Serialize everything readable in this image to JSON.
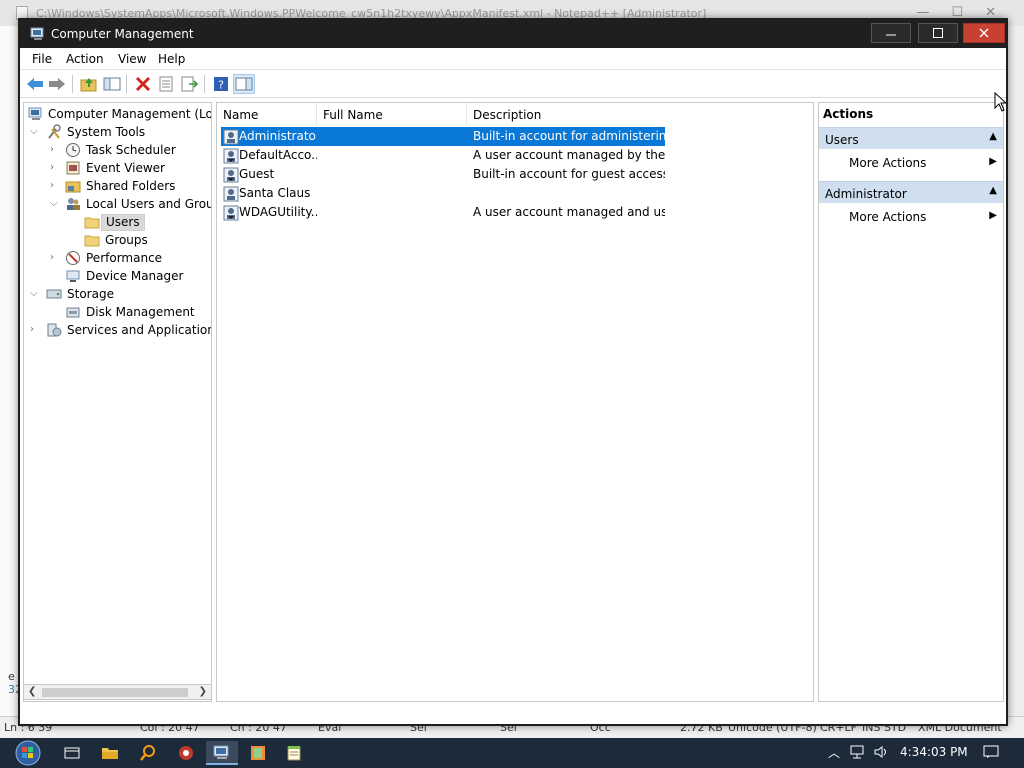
{
  "background_window": {
    "title": "C:\\Windows\\SystemApps\\Microsoft.Windows.PPWelcome_cw5n1h2txyewy\\AppxManifest.xml - Notepad++ [Administrator]",
    "edge_text": "e",
    "edge_text2": "32",
    "status": {
      "ln": "Ln : 6   39",
      "col": "Col : 20   47",
      "sel": "Ch : 20   47",
      "eval": "Eval",
      "sel2": "Sel",
      "sel3": "Sel",
      "occ": "Occ",
      "size": "2.72 KB",
      "encoding": "Unicode (UTF-8)",
      "eol": "CR+LF",
      "ins": "INS   STD",
      "type": "XML Document"
    }
  },
  "window": {
    "title": "Computer Management"
  },
  "menu": [
    "File",
    "Action",
    "View",
    "Help"
  ],
  "toolbar": {
    "buttons": [
      "back-arrow-icon",
      "forward-arrow-icon",
      "up-folder-icon",
      "show-hide-tree-icon",
      "delete-icon",
      "properties-icon",
      "export-list-icon",
      "help-icon",
      "show-hide-action-pane-icon"
    ]
  },
  "tree": {
    "items": [
      {
        "label": "Computer Management (Local",
        "icon": "computer-management-icon"
      },
      {
        "label": "System Tools",
        "icon": "system-tools-icon"
      },
      {
        "label": "Task Scheduler",
        "icon": "clock-icon"
      },
      {
        "label": "Event Viewer",
        "icon": "event-viewer-icon"
      },
      {
        "label": "Shared Folders",
        "icon": "shared-folders-icon"
      },
      {
        "label": "Local Users and Groups",
        "icon": "users-groups-icon"
      },
      {
        "label": "Users",
        "icon": "folder-icon"
      },
      {
        "label": "Groups",
        "icon": "folder-icon"
      },
      {
        "label": "Performance",
        "icon": "performance-icon"
      },
      {
        "label": "Device Manager",
        "icon": "device-manager-icon"
      },
      {
        "label": "Storage",
        "icon": "storage-icon"
      },
      {
        "label": "Disk Management",
        "icon": "disk-icon"
      },
      {
        "label": "Services and Applications",
        "icon": "services-icon"
      }
    ]
  },
  "list": {
    "columns": [
      "Name",
      "Full Name",
      "Description"
    ],
    "rows": [
      {
        "name": "Administrator",
        "full_name": "",
        "description": "Built-in account for administering..."
      },
      {
        "name": "DefaultAcco...",
        "full_name": "",
        "description": "A user account managed by the s..."
      },
      {
        "name": "Guest",
        "full_name": "",
        "description": "Built-in account for guest access t..."
      },
      {
        "name": "Santa Claus",
        "full_name": "",
        "description": ""
      },
      {
        "name": "WDAGUtility...",
        "full_name": "",
        "description": "A user account managed and use..."
      }
    ]
  },
  "actions": {
    "title": "Actions",
    "sections": [
      {
        "label": "Users",
        "item": "More Actions"
      },
      {
        "label": "Administrator",
        "item": "More Actions"
      }
    ]
  },
  "taskbar": {
    "clock": "4:34:03 PM",
    "colors": {
      "bg": "#1c2a3a",
      "selection": "#0a78d7",
      "close": "#c84031",
      "section": "#cfdff0"
    }
  }
}
